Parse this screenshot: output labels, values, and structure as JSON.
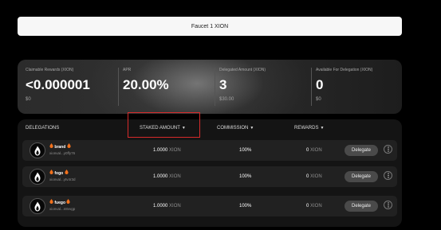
{
  "faucet_button": "Faucet 1 XION",
  "stats": [
    {
      "label": "Claimable Rewards (XION)",
      "value": "<0.000001",
      "sub": "$0"
    },
    {
      "label": "APR",
      "value": "20.00%",
      "sub": ""
    },
    {
      "label": "Delegated Amount (XION)",
      "value": "3",
      "sub": "$30.00"
    },
    {
      "label": "Available For Delegation (XION)",
      "value": "0",
      "sub": "$0"
    }
  ],
  "delegations": {
    "headers": {
      "delegations": "DELEGATIONS",
      "staked_amount": "STAKED AMOUNT",
      "commission": "COMMISSION",
      "rewards": "REWARDS"
    },
    "rows": [
      {
        "name": "brand",
        "address": "xionval...y0ffy76",
        "staked_value": "1.0000",
        "staked_unit": "XION",
        "commission": "100%",
        "rewards_value": "0",
        "rewards_unit": "XION",
        "action": "Delegate"
      },
      {
        "name": "fogo",
        "address": "xionval...ytv4r3d",
        "staked_value": "1.0000",
        "staked_unit": "XION",
        "commission": "100%",
        "rewards_value": "0",
        "rewards_unit": "XION",
        "action": "Delegate"
      },
      {
        "name": "fuego",
        "address": "xionval...n8vvgp",
        "staked_value": "1.0000",
        "staked_unit": "XION",
        "commission": "100%",
        "rewards_value": "0",
        "rewards_unit": "XION",
        "action": "Delegate"
      }
    ]
  },
  "icons": {
    "fire": "fire-icon",
    "validator_logo": "flame-logo-icon",
    "sort": "caret-down-icon",
    "more": "more-vertical-icon"
  },
  "colors": {
    "highlight": "#d62b2b",
    "fire": "#f2711c"
  }
}
